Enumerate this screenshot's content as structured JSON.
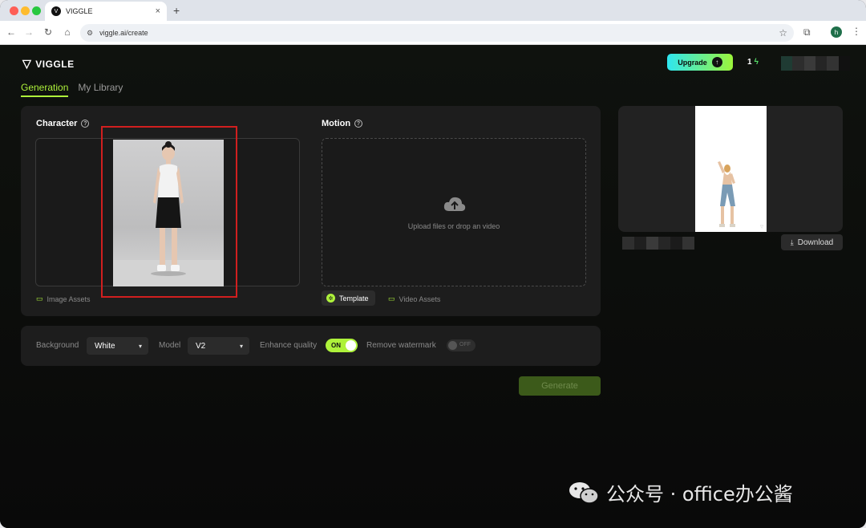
{
  "browser": {
    "tab_title": "VIGGLE",
    "tab_close": "×",
    "new_tab": "+",
    "url": "viggle.ai/create",
    "profile_initial": "h"
  },
  "header": {
    "logo_text": "VIGGLE",
    "upgrade_label": "Upgrade",
    "credits": "1",
    "accent_color": "#aef23b"
  },
  "tabs": [
    {
      "label": "Generation",
      "active": true
    },
    {
      "label": "My Library",
      "active": false
    }
  ],
  "character": {
    "title": "Character",
    "assets_label": "Image Assets"
  },
  "motion": {
    "title": "Motion",
    "upload_text": "Upload files or drop an video",
    "template_label": "Template",
    "assets_label": "Video Assets"
  },
  "settings": {
    "background_label": "Background",
    "background_value": "White",
    "model_label": "Model",
    "model_value": "V2",
    "enhance_label": "Enhance quality",
    "enhance_state": "ON",
    "watermark_label": "Remove watermark",
    "watermark_state": "OFF"
  },
  "generate_label": "Generate",
  "preview": {
    "download_label": "Download"
  },
  "overlay_watermark": "公众号 · office办公酱"
}
